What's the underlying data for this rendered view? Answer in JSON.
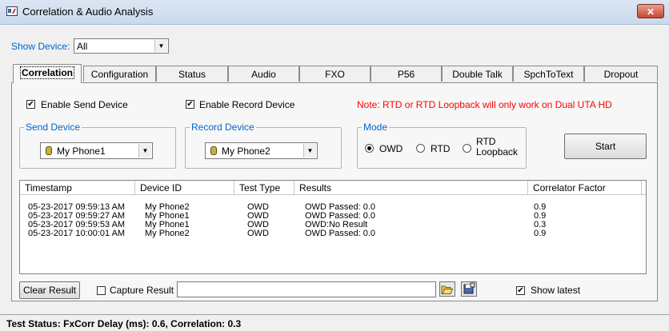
{
  "window": {
    "title": "Correlation & Audio Analysis",
    "close_label": "✕"
  },
  "show_device": {
    "label": "Show Device:",
    "value": "All"
  },
  "tabs": [
    {
      "label": "Correlation"
    },
    {
      "label": "Configuration"
    },
    {
      "label": "Status"
    },
    {
      "label": "Audio"
    },
    {
      "label": "FXO"
    },
    {
      "label": "P56"
    },
    {
      "label": "Double Talk"
    },
    {
      "label": "SpchToText"
    },
    {
      "label": "Dropout"
    }
  ],
  "correlation": {
    "enable_send": {
      "label": "Enable Send Device",
      "checked": true
    },
    "enable_record": {
      "label": "Enable Record Device",
      "checked": true
    },
    "note": "Note: RTD or RTD Loopback will only work on Dual UTA HD",
    "send_device": {
      "label": "Send Device",
      "value": "My Phone1"
    },
    "record_device": {
      "label": "Record Device",
      "value": "My Phone2"
    },
    "mode": {
      "label": "Mode",
      "options": [
        {
          "label": "OWD",
          "selected": true
        },
        {
          "label": "RTD",
          "selected": false
        },
        {
          "label_line1": "RTD",
          "label_line2": "Loopback",
          "selected": false
        }
      ]
    },
    "start_label": "Start",
    "table": {
      "columns": [
        "Timestamp",
        "Device ID",
        "Test Type",
        "Results",
        "Correlator Factor"
      ],
      "rows": [
        [
          "05-23-2017 09:59:13 AM",
          "My Phone2",
          "OWD",
          "OWD Passed:  0.0",
          "0.9"
        ],
        [
          "05-23-2017 09:59:27 AM",
          "My Phone1",
          "OWD",
          "OWD Passed:  0.0",
          "0.9"
        ],
        [
          "05-23-2017 09:59:53 AM",
          "My Phone1",
          "OWD",
          "OWD:No Result",
          "0.3"
        ],
        [
          "05-23-2017 10:00:01 AM",
          "My Phone2",
          "OWD",
          "OWD Passed:  0.0",
          "0.9"
        ]
      ]
    },
    "clear_result_label": "Clear Result",
    "capture_result": {
      "label": "Capture Result",
      "checked": false,
      "path": ""
    },
    "show_latest": {
      "label": "Show latest",
      "checked": true
    }
  },
  "status_bar": {
    "text": "Test Status: FxCorr Delay (ms): 0.6, Correlation: 0.3"
  },
  "colors": {
    "accent_blue": "#0066cc",
    "note_red": "#ff0000"
  }
}
